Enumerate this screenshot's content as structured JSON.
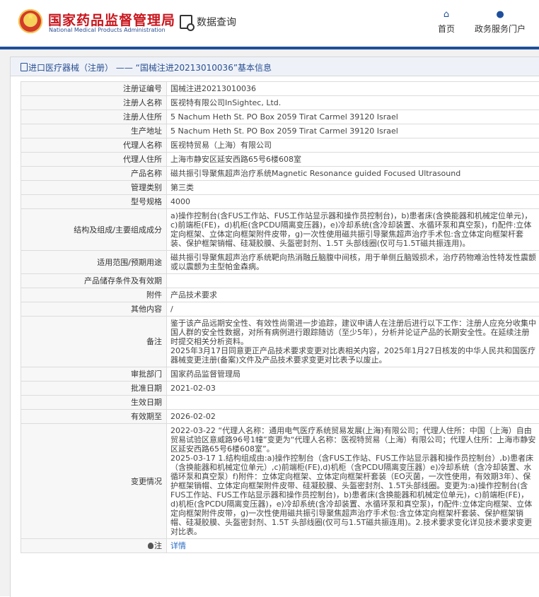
{
  "header": {
    "logo_cn": "国家药品监督管理局",
    "logo_en": "National Medical Products Administration",
    "module_label": "数据查询",
    "nav": [
      {
        "label": "首页",
        "icon": "home-icon"
      },
      {
        "label": "政务服务门户",
        "icon": "user-icon"
      }
    ]
  },
  "breadcrumb": {
    "text": "进口医疗器械（注册） —— “国械注进20213010036”基本信息"
  },
  "rows": [
    {
      "key": "注册证编号",
      "value": "国械注进20213010036"
    },
    {
      "key": "注册人名称",
      "value": "医视特有限公司InSightec, Ltd."
    },
    {
      "key": "注册人住所",
      "value": "5 Nachum Heth St. PO Box 2059 Tirat Carmel 39120 Israel"
    },
    {
      "key": "生产地址",
      "value": "5 Nachum Heth St. PO Box 2059 Tirat Carmel 39120 Israel"
    },
    {
      "key": "代理人名称",
      "value": "医视特贸易（上海）有限公司"
    },
    {
      "key": "代理人住所",
      "value": "上海市静安区延安西路65号6楼608室"
    },
    {
      "key": "产品名称",
      "value": "磁共振引导聚焦超声治疗系统Magnetic Resonance guided Focused Ultrasound"
    },
    {
      "key": "管理类别",
      "value": "第三类"
    },
    {
      "key": "型号规格",
      "value": "4000"
    },
    {
      "key": "结构及组成/主要组成成分",
      "value": "a)操作控制台(含FUS工作站、FUS工作站显示器和操作员控制台)，b)患者床(含换能器和机械定位单元)，c)前端柜(FE)，d)机柜(含PCDU隔离变压器)，e)冷却系统(含冷却装置、水循环泵和真空泵)，f)配件:立体定向框架、立体定向框架附件皮带，g)一次性使用磁共振引导聚焦超声治疗手术包:含立体定向框架杆套装、保护框架销帽、硅凝胶膜、头盔密封剂、1.5T 头部线圈(仅可与1.5T磁共振连用)。"
    },
    {
      "key": "适用范围/预期用途",
      "value": "磁共振引导聚焦超声治疗系统靶向热消融丘脑腹中间核，用于单侧丘脑毁损术，治疗药物难治性特发性震颤或以震颤为主型帕金森病。"
    },
    {
      "key": "产品储存条件及有效期",
      "value": ""
    },
    {
      "key": "附件",
      "value": "产品技术要求"
    },
    {
      "key": "其他内容",
      "value": "/"
    },
    {
      "key": "备注",
      "value": "鉴于该产品远期安全性、有效性尚需进一步追踪，建议申请人在注册后进行以下工作：注册人应充分收集中国人群的安全性数据，对所有病例进行跟踪随访（至少5年），分析并论证产品的长期安全性。在延续注册时提交相关分析资料。\n2025年3月17日同意更正产品技术要求变更对比表相关内容，2025年1月27日核发的中华人民共和国医疗器械变更注册(备案)文件及产品技术要求变更对比表予以废止。"
    },
    {
      "key": "审批部门",
      "value": "国家药品监督管理局"
    },
    {
      "key": "批准日期",
      "value": "2021-02-03"
    },
    {
      "key": "生效日期",
      "value": ""
    },
    {
      "key": "有效期至",
      "value": "2026-02-02"
    },
    {
      "key": "变更情况",
      "value": "2022-03-22 “代理人名称：通用电气医疗系统贸易发展(上海)有限公司；代理人住所：中国（上海）自由贸易试验区意威路96号1幢”变更为“代理人名称：医视特贸易（上海）有限公司；代理人住所：上海市静安区延安西路65号6楼608室”。\n2025-03-17 1.结构组成由:a)操作控制台（含FUS工作站、FUS工作站显示器和操作员控制台）,b)患者床（含换能器和机械定位单元）,c)前端柜(FE),d)机柜（含PCDU隔离变压器）e)冷却系统（含冷却装置、水循环泵和真空泵）f)附件：立体定向框架、立体定向框架杆套装（EO灭菌，一次性使用，有效期3年）、保护框架销帽、立体定向框架附件皮带、硅凝胶膜、头盔密封剂、1.5T头部线圈。变更为:a)操作控制台(含FUS工作站、FUS工作站显示器和操作员控制台)，b)患者床(含换能器和机械定位单元)，c)前端柜(FE)，d)机柜(含PCDU隔离变压器)，e)冷却系统(含冷却装置、水循环泵和真空泵)，f)配件:立体定向框架、立体定向框架附件皮带，g)一次性使用磁共振引导聚焦超声治疗手术包:含立体定向框架杆套装、保护框架销帽、硅凝胶膜、头盔密封剂、1.5T 头部线圈(仅可与1.5T磁共振连用)。2.技术要求变化详见技术要求变更对比表。"
    }
  ],
  "note_row": {
    "key": "注",
    "icon": "bulb-icon",
    "link": "详情"
  }
}
